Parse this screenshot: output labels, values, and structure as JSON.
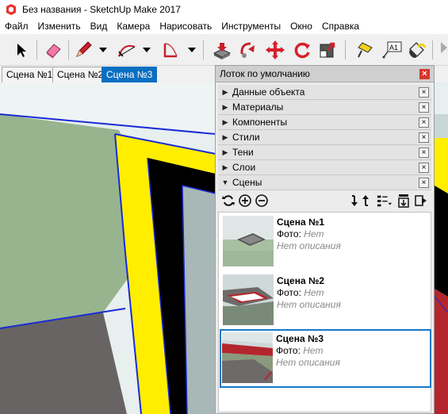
{
  "window": {
    "title": "Без названия - SketchUp Make 2017",
    "app_icon": "sketchup-icon"
  },
  "menu": [
    "Файл",
    "Изменить",
    "Вид",
    "Камера",
    "Нарисовать",
    "Инструменты",
    "Окно",
    "Справка"
  ],
  "toolbar": {
    "tools": [
      {
        "name": "select-tool",
        "icon": "arrow-cursor-icon"
      },
      {
        "name": "eraser-tool",
        "icon": "eraser-icon"
      },
      {
        "name": "pencil-tool",
        "icon": "pencil-icon"
      },
      {
        "name": "arc-tool",
        "icon": "arc-icon"
      },
      {
        "name": "rectangle-tool",
        "icon": "rectangle-icon"
      },
      {
        "name": "push-pull-tool",
        "icon": "push-pull-icon"
      },
      {
        "name": "follow-me-tool",
        "icon": "follow-me-icon"
      },
      {
        "name": "move-tool",
        "icon": "move-icon"
      },
      {
        "name": "rotate-tool",
        "icon": "rotate-icon"
      },
      {
        "name": "scale-tool",
        "icon": "scale-icon"
      },
      {
        "name": "tape-measure-tool",
        "icon": "tape-measure-icon"
      },
      {
        "name": "text-tool",
        "icon": "text-label-icon",
        "text": "A1"
      },
      {
        "name": "paint-bucket-tool",
        "icon": "paint-bucket-icon"
      }
    ]
  },
  "scene_tabs": [
    {
      "label": "Сцена №1",
      "active": false
    },
    {
      "label": "Сцена №2",
      "active": false
    },
    {
      "label": "Сцена №3",
      "active": true
    }
  ],
  "tray": {
    "title": "Лоток по умолчанию",
    "close": "×",
    "panels": [
      {
        "label": "Данные объекта",
        "expanded": false
      },
      {
        "label": "Материалы",
        "expanded": false
      },
      {
        "label": "Компоненты",
        "expanded": false
      },
      {
        "label": "Стили",
        "expanded": false
      },
      {
        "label": "Тени",
        "expanded": false
      },
      {
        "label": "Слои",
        "expanded": false
      },
      {
        "label": "Сцены",
        "expanded": true
      }
    ],
    "panel_close": "×",
    "scene_tools": [
      "refresh-icon",
      "add-icon",
      "remove-icon",
      "move-down-icon",
      "move-up-icon",
      "view-options-icon",
      "scene-settings-icon",
      "details-icon"
    ],
    "scenes": [
      {
        "name": "Сцена №1",
        "photo_label": "Фото:",
        "photo_value": "Нет",
        "description": "Нет описания",
        "selected": false
      },
      {
        "name": "Сцена №2",
        "photo_label": "Фото:",
        "photo_value": "Нет",
        "description": "Нет описания",
        "selected": false
      },
      {
        "name": "Сцена №3",
        "photo_label": "Фото:",
        "photo_value": "Нет",
        "description": "Нет описания",
        "selected": true
      }
    ]
  },
  "colors": {
    "accent": "#0a6fc2",
    "selection": "#1679c9",
    "frame_yellow": "#ffee00",
    "frame_black": "#000000",
    "edge_blue": "#1a2bd6",
    "ground_green": "#97b48f",
    "floor_gray": "#686463",
    "close_red": "#d9352b"
  }
}
